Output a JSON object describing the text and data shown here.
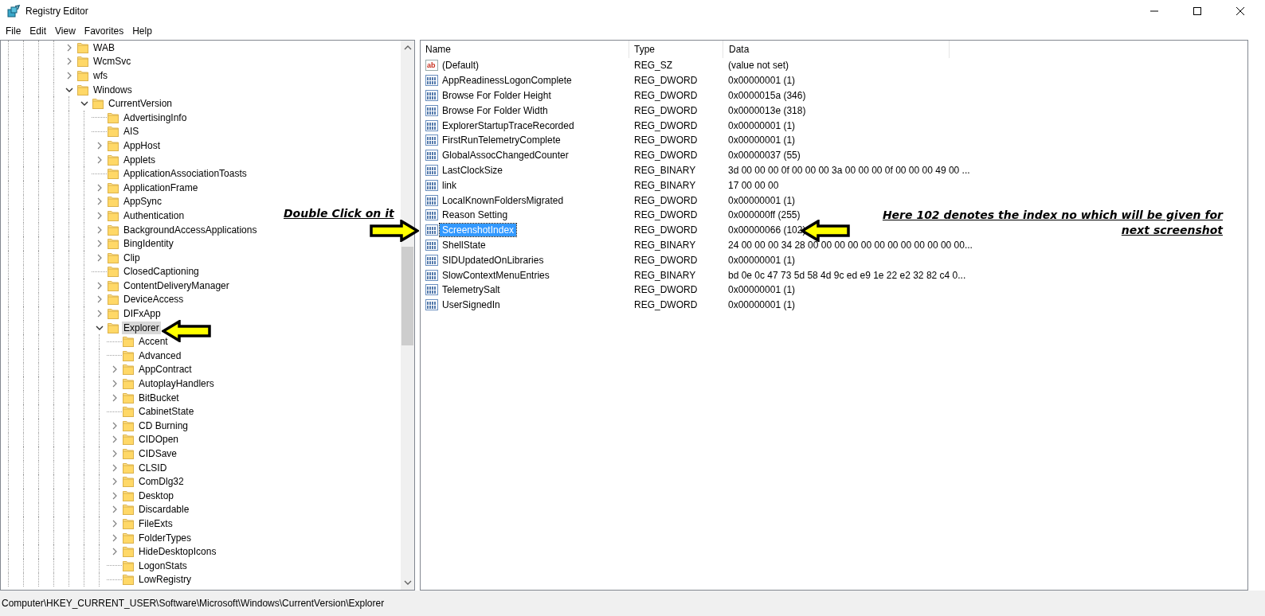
{
  "window": {
    "title": "Registry Editor"
  },
  "menu": [
    "File",
    "Edit",
    "View",
    "Favorites",
    "Help"
  ],
  "tree": [
    {
      "label": "WAB",
      "expandable": true,
      "expanded": false,
      "selected": false
    },
    {
      "label": "WcmSvc",
      "expandable": true,
      "expanded": false,
      "selected": false
    },
    {
      "label": "wfs",
      "expandable": true,
      "expanded": false,
      "selected": false
    },
    {
      "label": "Windows",
      "expandable": true,
      "expanded": true,
      "selected": false,
      "children": [
        {
          "label": "CurrentVersion",
          "expandable": true,
          "expanded": true,
          "selected": false,
          "children": [
            {
              "label": "AdvertisingInfo",
              "expandable": false,
              "selected": false
            },
            {
              "label": "AIS",
              "expandable": false,
              "selected": false
            },
            {
              "label": "AppHost",
              "expandable": true,
              "expanded": false,
              "selected": false
            },
            {
              "label": "Applets",
              "expandable": true,
              "expanded": false,
              "selected": false
            },
            {
              "label": "ApplicationAssociationToasts",
              "expandable": false,
              "selected": false
            },
            {
              "label": "ApplicationFrame",
              "expandable": true,
              "expanded": false,
              "selected": false
            },
            {
              "label": "AppSync",
              "expandable": true,
              "expanded": false,
              "selected": false
            },
            {
              "label": "Authentication",
              "expandable": true,
              "expanded": false,
              "selected": false
            },
            {
              "label": "BackgroundAccessApplications",
              "expandable": true,
              "expanded": false,
              "selected": false
            },
            {
              "label": "BingIdentity",
              "expandable": true,
              "expanded": false,
              "selected": false
            },
            {
              "label": "Clip",
              "expandable": true,
              "expanded": false,
              "selected": false
            },
            {
              "label": "ClosedCaptioning",
              "expandable": false,
              "selected": false
            },
            {
              "label": "ContentDeliveryManager",
              "expandable": true,
              "expanded": false,
              "selected": false
            },
            {
              "label": "DeviceAccess",
              "expandable": true,
              "expanded": false,
              "selected": false
            },
            {
              "label": "DIFxApp",
              "expandable": true,
              "expanded": false,
              "selected": false
            },
            {
              "label": "Explorer",
              "expandable": true,
              "expanded": true,
              "selected": true,
              "children": [
                {
                  "label": "Accent",
                  "expandable": false,
                  "selected": false
                },
                {
                  "label": "Advanced",
                  "expandable": false,
                  "selected": false
                },
                {
                  "label": "AppContract",
                  "expandable": true,
                  "expanded": false,
                  "selected": false
                },
                {
                  "label": "AutoplayHandlers",
                  "expandable": true,
                  "expanded": false,
                  "selected": false
                },
                {
                  "label": "BitBucket",
                  "expandable": true,
                  "expanded": false,
                  "selected": false
                },
                {
                  "label": "CabinetState",
                  "expandable": false,
                  "selected": false
                },
                {
                  "label": "CD Burning",
                  "expandable": true,
                  "expanded": false,
                  "selected": false
                },
                {
                  "label": "CIDOpen",
                  "expandable": true,
                  "expanded": false,
                  "selected": false
                },
                {
                  "label": "CIDSave",
                  "expandable": true,
                  "expanded": false,
                  "selected": false
                },
                {
                  "label": "CLSID",
                  "expandable": true,
                  "expanded": false,
                  "selected": false
                },
                {
                  "label": "ComDlg32",
                  "expandable": true,
                  "expanded": false,
                  "selected": false
                },
                {
                  "label": "Desktop",
                  "expandable": true,
                  "expanded": false,
                  "selected": false
                },
                {
                  "label": "Discardable",
                  "expandable": true,
                  "expanded": false,
                  "selected": false
                },
                {
                  "label": "FileExts",
                  "expandable": true,
                  "expanded": false,
                  "selected": false
                },
                {
                  "label": "FolderTypes",
                  "expandable": true,
                  "expanded": false,
                  "selected": false
                },
                {
                  "label": "HideDesktopIcons",
                  "expandable": true,
                  "expanded": false,
                  "selected": false
                },
                {
                  "label": "LogonStats",
                  "expandable": false,
                  "selected": false
                },
                {
                  "label": "LowRegistry",
                  "expandable": false,
                  "selected": false
                }
              ]
            }
          ]
        }
      ]
    }
  ],
  "table": {
    "columns": [
      "Name",
      "Type",
      "Data"
    ],
    "rows": [
      {
        "kind": "string",
        "icon_label": "ab",
        "name": "(Default)",
        "type": "REG_SZ",
        "data": "(value not set)",
        "selected": false
      },
      {
        "kind": "binary",
        "name": "AppReadinessLogonComplete",
        "type": "REG_DWORD",
        "data": "0x00000001 (1)",
        "selected": false
      },
      {
        "kind": "binary",
        "name": "Browse For Folder Height",
        "type": "REG_DWORD",
        "data": "0x0000015a (346)",
        "selected": false
      },
      {
        "kind": "binary",
        "name": "Browse For Folder Width",
        "type": "REG_DWORD",
        "data": "0x0000013e (318)",
        "selected": false
      },
      {
        "kind": "binary",
        "name": "ExplorerStartupTraceRecorded",
        "type": "REG_DWORD",
        "data": "0x00000001 (1)",
        "selected": false
      },
      {
        "kind": "binary",
        "name": "FirstRunTelemetryComplete",
        "type": "REG_DWORD",
        "data": "0x00000001 (1)",
        "selected": false
      },
      {
        "kind": "binary",
        "name": "GlobalAssocChangedCounter",
        "type": "REG_DWORD",
        "data": "0x00000037 (55)",
        "selected": false
      },
      {
        "kind": "binary",
        "name": "LastClockSize",
        "type": "REG_BINARY",
        "data": "3d 00 00 00 0f 00 00 00 3a 00 00 00 0f 00 00 00 49 00 ...",
        "selected": false
      },
      {
        "kind": "binary",
        "name": "link",
        "type": "REG_BINARY",
        "data": "17 00 00 00",
        "selected": false
      },
      {
        "kind": "binary",
        "name": "LocalKnownFoldersMigrated",
        "type": "REG_DWORD",
        "data": "0x00000001 (1)",
        "selected": false
      },
      {
        "kind": "binary",
        "name": "Reason Setting",
        "type": "REG_DWORD",
        "data": "0x000000ff (255)",
        "selected": false
      },
      {
        "kind": "binary",
        "name": "ScreenshotIndex",
        "type": "REG_DWORD",
        "data": "0x00000066 (102)",
        "selected": true
      },
      {
        "kind": "binary",
        "name": "ShellState",
        "type": "REG_BINARY",
        "data": "24 00 00 00 34 28 00 00 00 00 00 00 00 00 00 00 00 00...",
        "selected": false
      },
      {
        "kind": "binary",
        "name": "SIDUpdatedOnLibraries",
        "type": "REG_DWORD",
        "data": "0x00000001 (1)",
        "selected": false
      },
      {
        "kind": "binary",
        "name": "SlowContextMenuEntries",
        "type": "REG_BINARY",
        "data": "bd 0e 0c 47 73 5d 58 4d 9c ed e9 1e 22 e2 32 82 c4 0...",
        "selected": false
      },
      {
        "kind": "binary",
        "name": "TelemetrySalt",
        "type": "REG_DWORD",
        "data": "0x00000001 (1)",
        "selected": false
      },
      {
        "kind": "binary",
        "name": "UserSignedIn",
        "type": "REG_DWORD",
        "data": "0x00000001 (1)",
        "selected": false
      }
    ]
  },
  "annotations": [
    {
      "kind": "double-click",
      "text": "Double Click on it"
    },
    {
      "kind": "index-note",
      "text": "Here 102 denotes the index no which will be given for next screenshot"
    }
  ],
  "status_bar": "Computer\\HKEY_CURRENT_USER\\Software\\Microsoft\\Windows\\CurrentVersion\\Explorer"
}
